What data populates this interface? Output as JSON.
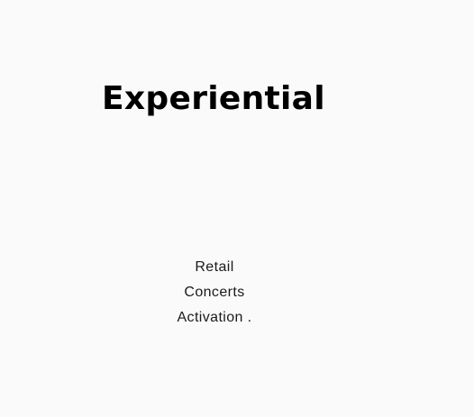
{
  "section": {
    "title": "Experiential",
    "items": [
      {
        "label": "Retail"
      },
      {
        "label": "Concerts"
      },
      {
        "label": "Activation ."
      }
    ]
  },
  "colors": {
    "background": "#fafafa",
    "heading": "#000000",
    "text": "#1a1a1a"
  }
}
